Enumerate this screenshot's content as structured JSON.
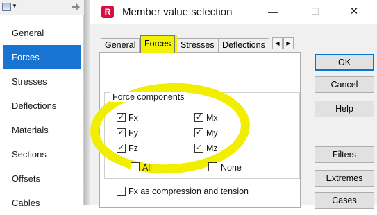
{
  "side_panel": {
    "items": [
      {
        "label": "General"
      },
      {
        "label": "Forces",
        "active": true
      },
      {
        "label": "Stresses"
      },
      {
        "label": "Deflections"
      },
      {
        "label": "Materials"
      },
      {
        "label": "Sections"
      },
      {
        "label": "Offsets"
      },
      {
        "label": "Cables"
      }
    ]
  },
  "dialog": {
    "title": "Member value selection",
    "app_icon_letter": "R",
    "tabs": [
      {
        "label": "General"
      },
      {
        "label": "Forces",
        "selected": true
      },
      {
        "label": "Stresses"
      },
      {
        "label": "Deflections"
      }
    ],
    "group": {
      "title": "Force components",
      "components": [
        {
          "label": "Fx",
          "checked": true
        },
        {
          "label": "Fy",
          "checked": true
        },
        {
          "label": "Fz",
          "checked": true
        },
        {
          "label": "Mx",
          "checked": true
        },
        {
          "label": "My",
          "checked": true
        },
        {
          "label": "Mz",
          "checked": true
        }
      ],
      "all_label": "All",
      "none_label": "None"
    },
    "fx_compression_label": "Fx as compression and tension",
    "buttons": {
      "ok": "OK",
      "cancel": "Cancel",
      "help": "Help",
      "filters": "Filters",
      "extremes": "Extremes",
      "cases": "Cases"
    }
  },
  "colors": {
    "accent": "#1874d2",
    "highlight": "#f1ee00",
    "app_icon": "#d3123e"
  }
}
